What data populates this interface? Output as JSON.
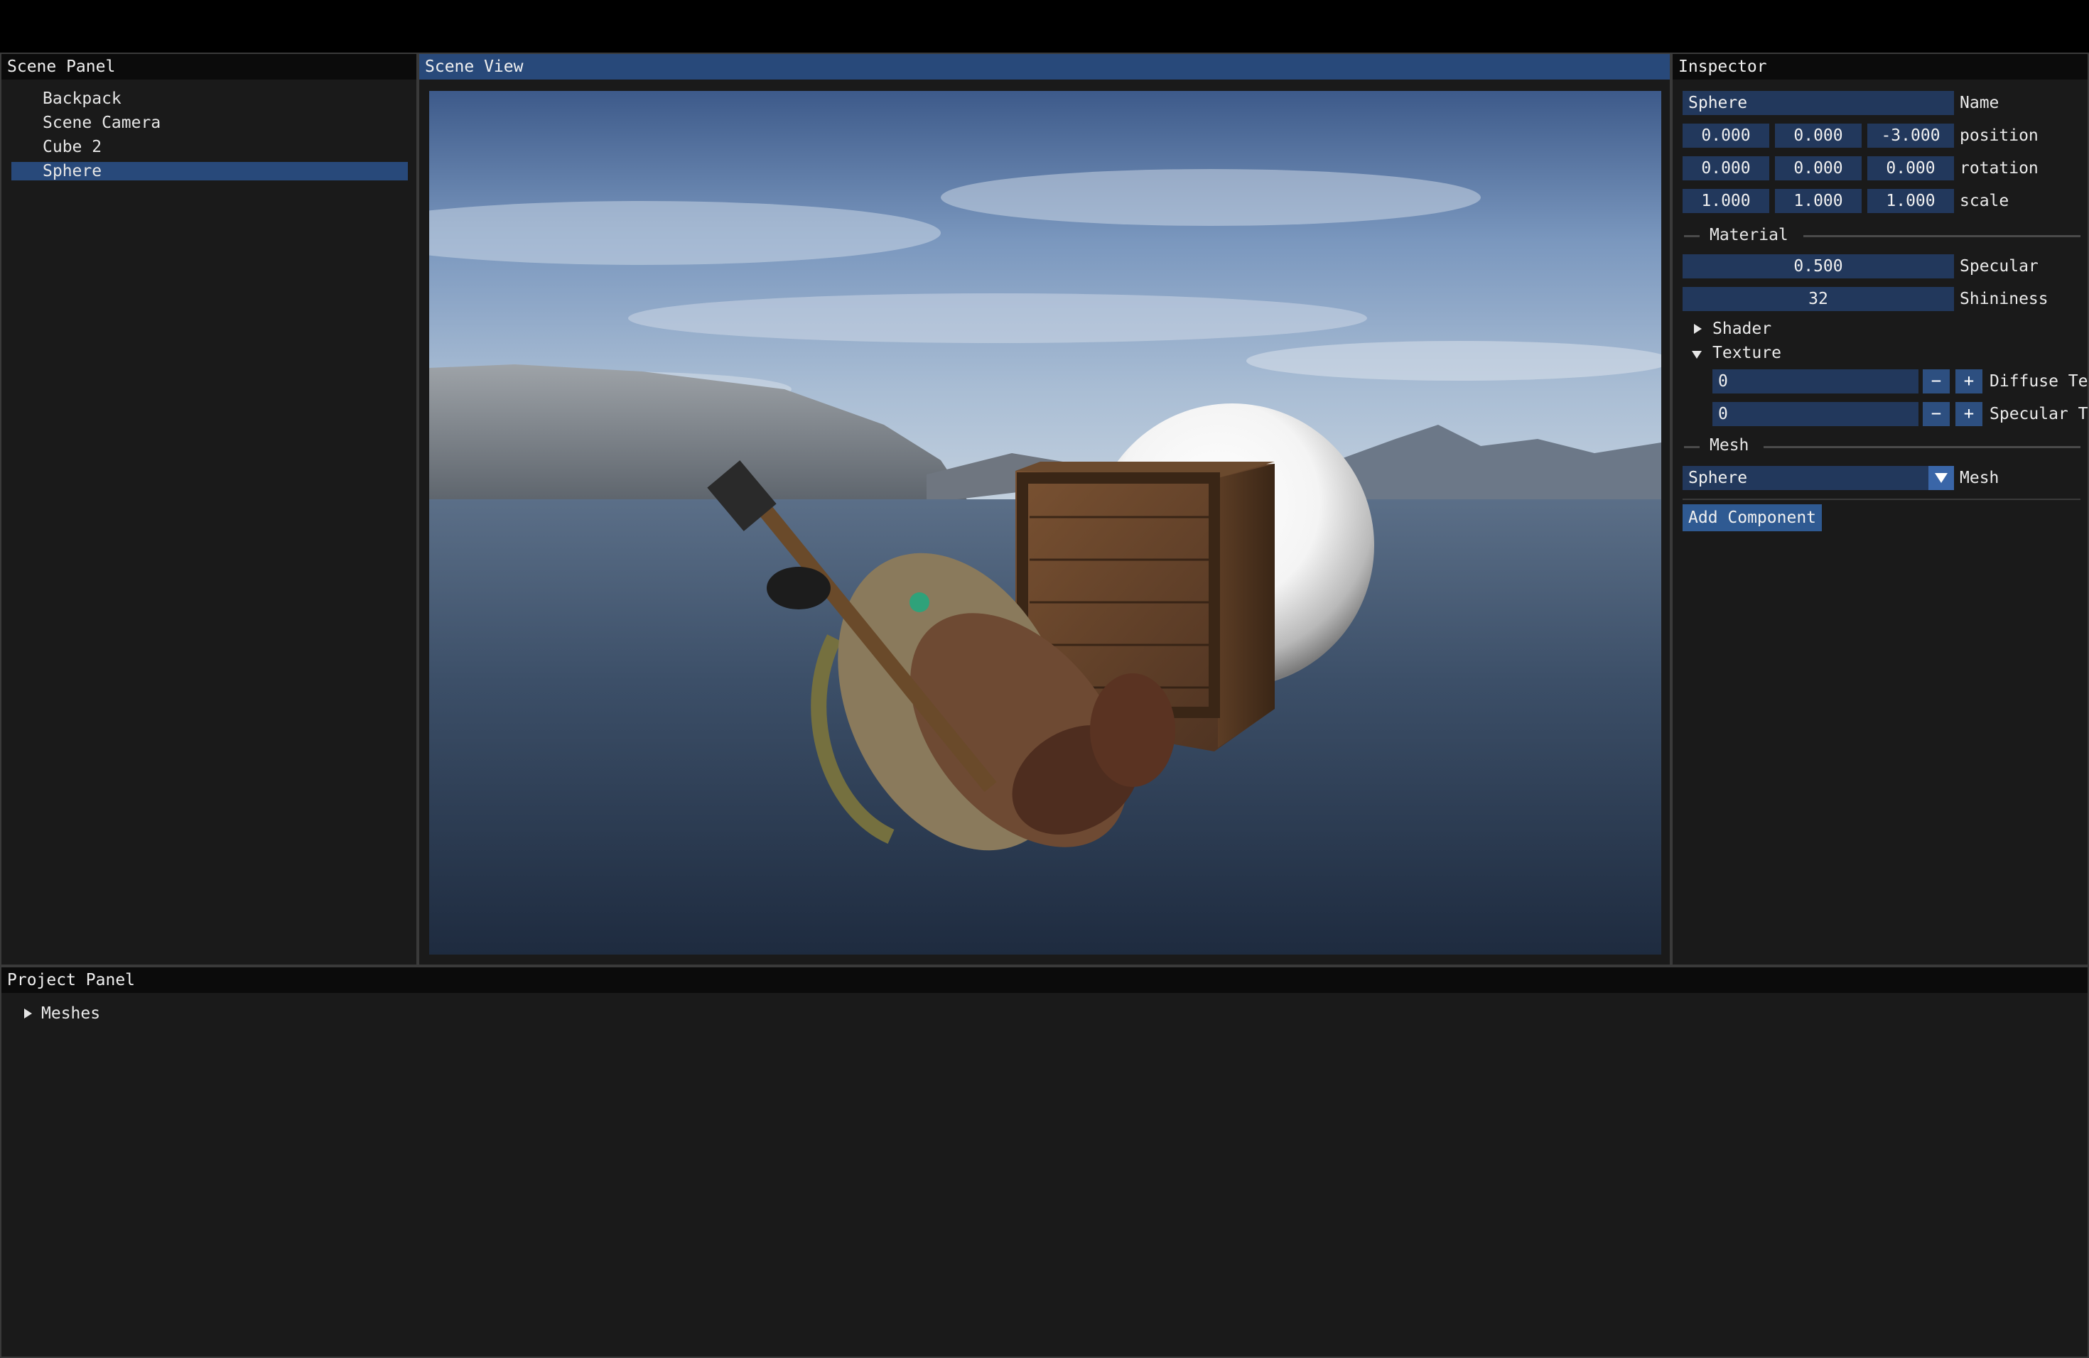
{
  "scene_panel": {
    "title": "Scene Panel",
    "items": [
      {
        "label": "Backpack"
      },
      {
        "label": "Scene Camera"
      },
      {
        "label": "Cube 2"
      },
      {
        "label": "Sphere"
      }
    ]
  },
  "scene_view": {
    "title": "Scene View"
  },
  "inspector": {
    "title": "Inspector",
    "name_value": "Sphere",
    "name_label": "Name",
    "position": {
      "x": "0.000",
      "y": "0.000",
      "z": "-3.000",
      "label": "position"
    },
    "rotation": {
      "x": "0.000",
      "y": "0.000",
      "z": "0.000",
      "label": "rotation"
    },
    "scale": {
      "x": "1.000",
      "y": "1.000",
      "z": "1.000",
      "label": "scale"
    },
    "material": {
      "header": "Material",
      "specular_value": "0.500",
      "specular_label": "Specular",
      "shininess_value": "32",
      "shininess_label": "Shininess",
      "shader_label": "Shader",
      "texture_label": "Texture",
      "diffuse_value": "0",
      "diffuse_label": "Diffuse Te",
      "specular_tex_value": "0",
      "specular_tex_label": "Specular T",
      "minus": "−",
      "plus": "+"
    },
    "mesh": {
      "header": "Mesh",
      "selected": "Sphere",
      "label": "Mesh"
    },
    "add_component": "Add Component"
  },
  "project_panel": {
    "title": "Project Panel",
    "items": [
      {
        "label": "Meshes"
      }
    ]
  },
  "colors": {
    "panel_bg": "#1a1a1a",
    "title_bg": "#0b0b0b",
    "active_title": "#28497a",
    "field_bg": "#22385c",
    "selection": "#28497a"
  }
}
